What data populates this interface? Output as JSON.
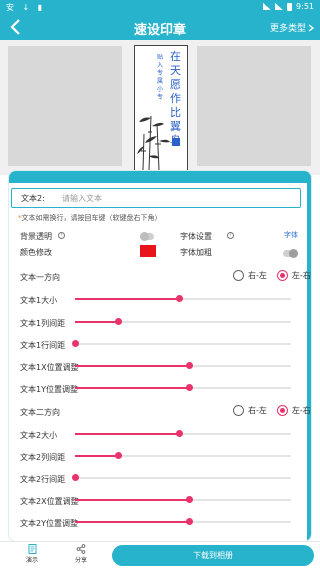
{
  "status_bar": {
    "left_icons": "安 ↓ ▮",
    "time": "9:51"
  },
  "app_bar": {
    "title": "速设印章",
    "more_label": "更多类型"
  },
  "stamp_preview": {
    "main_text": "在天愿作比翼鸟",
    "sub_text": "贴入专属小专"
  },
  "text2": {
    "label": "文本2:",
    "placeholder": "请输入文本",
    "value": ""
  },
  "hint": {
    "star": "*",
    "text": "文本如需换行，请按回车键（软键盘右下角）"
  },
  "settings": {
    "bg_transparent_label": "背景透明",
    "font_settings_label": "字体设置",
    "font_link": "字体",
    "color_edit_label": "颜色修改",
    "font_bold_label": "字体加粗",
    "color_value": "#e8141a",
    "bg_transparent_on": false,
    "font_bold_on": false
  },
  "text1": {
    "direction_label": "文本一方向",
    "option_right_left": "右-左",
    "option_left_right": "左-右",
    "selected": "左-右",
    "sliders": [
      {
        "label": "文本1大小",
        "value": 0.48
      },
      {
        "label": "文本1列间距",
        "value": 0.2
      },
      {
        "label": "文本1行间距",
        "value": 0.0
      },
      {
        "label": "文本1X位置调整",
        "value": 0.53
      },
      {
        "label": "文本1Y位置调整",
        "value": 0.53
      }
    ]
  },
  "text2_settings": {
    "direction_label": "文本二方向",
    "option_right_left": "右-左",
    "option_left_right": "左-右",
    "selected": "左-右",
    "sliders": [
      {
        "label": "文本2大小",
        "value": 0.48
      },
      {
        "label": "文本2列间距",
        "value": 0.2
      },
      {
        "label": "文本2行间距",
        "value": 0.0
      },
      {
        "label": "文本2X位置调整",
        "value": 0.53
      },
      {
        "label": "文本2Y位置调整",
        "value": 0.53
      }
    ]
  },
  "bottom_bar": {
    "demo_label": "演示",
    "share_label": "分享",
    "download_label": "下载到相册"
  },
  "colors": {
    "accent": "#28b3cc",
    "slider": "#e8336b"
  }
}
